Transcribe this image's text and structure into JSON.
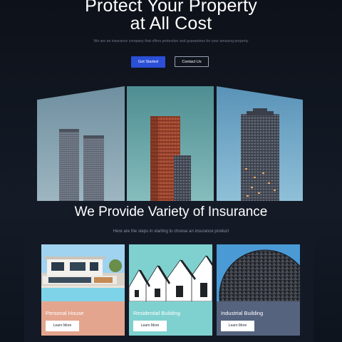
{
  "hero": {
    "title_line1": "Protect Your Property",
    "title_line2": "at All Cost",
    "subtitle": "We are an insurance company that offers protection and guarantees for your amazing property",
    "primary_button": "Get Started",
    "secondary_button": "Contact Us"
  },
  "services": {
    "title": "We Provide Variety of Insurance",
    "subtitle": "Here are the steps in starting to choose an insurance product",
    "cards": [
      {
        "label": "Personal House",
        "button": "Learn More"
      },
      {
        "label": "Residential Building",
        "button": "Learn More"
      },
      {
        "label": "Industrial Building",
        "button": "Learn More"
      }
    ]
  },
  "colors": {
    "background": "#0d1119",
    "accent": "#2b4fd6",
    "card_personal": "#e4a58f",
    "card_residential": "#7fd1d0",
    "card_industrial": "#55637f"
  },
  "icons": []
}
